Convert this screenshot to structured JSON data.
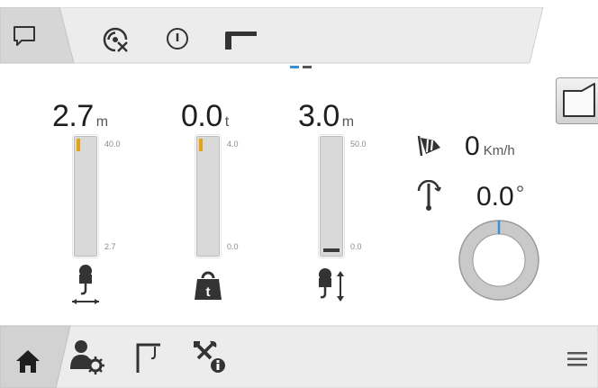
{
  "top_bar": {
    "icons": [
      "message-icon",
      "no-signal-icon",
      "power-icon",
      "boom-icon"
    ],
    "page_indicator": {
      "pages": 2,
      "active": 0
    }
  },
  "gauges": [
    {
      "name": "hook-radius",
      "value": "2.7",
      "unit": "m",
      "max_label": "40.0",
      "min_label": "2.7",
      "icon": "hook-radius-icon",
      "fill_fraction": 0.04
    },
    {
      "name": "load",
      "value": "0.0",
      "unit": "t",
      "max_label": "4.0",
      "min_label": "0.0",
      "icon": "weight-icon",
      "fill_fraction": 0.04
    },
    {
      "name": "hook-height",
      "value": "3.0",
      "unit": "m",
      "max_label": "50.0",
      "min_label": "0.0",
      "icon": "hook-height-icon",
      "fill_fraction": 0.0
    }
  ],
  "wind": {
    "value": "0",
    "unit": "Km/h",
    "icon": "wind-sock-icon"
  },
  "slew": {
    "value": "0.0",
    "unit": "°",
    "icon": "slew-icon",
    "angle_deg": 0
  },
  "corner_button": {
    "icon": "view-corner-icon"
  },
  "bottom_nav": {
    "items": [
      {
        "name": "home",
        "icon": "home-icon",
        "active": true
      },
      {
        "name": "operator-settings",
        "icon": "user-settings-icon",
        "active": false
      },
      {
        "name": "crane-config",
        "icon": "crane-config-icon",
        "active": false
      },
      {
        "name": "service",
        "icon": "tools-info-icon",
        "active": false
      }
    ],
    "menu_icon": "menu-icon"
  },
  "colors": {
    "bar_bg": "#e4e4e4",
    "accent_yellow": "#e8a20c",
    "indicator_blue": "#3a8fd9",
    "slew_ring": "#c7c7c7",
    "slew_needle": "#3a8fd9"
  }
}
